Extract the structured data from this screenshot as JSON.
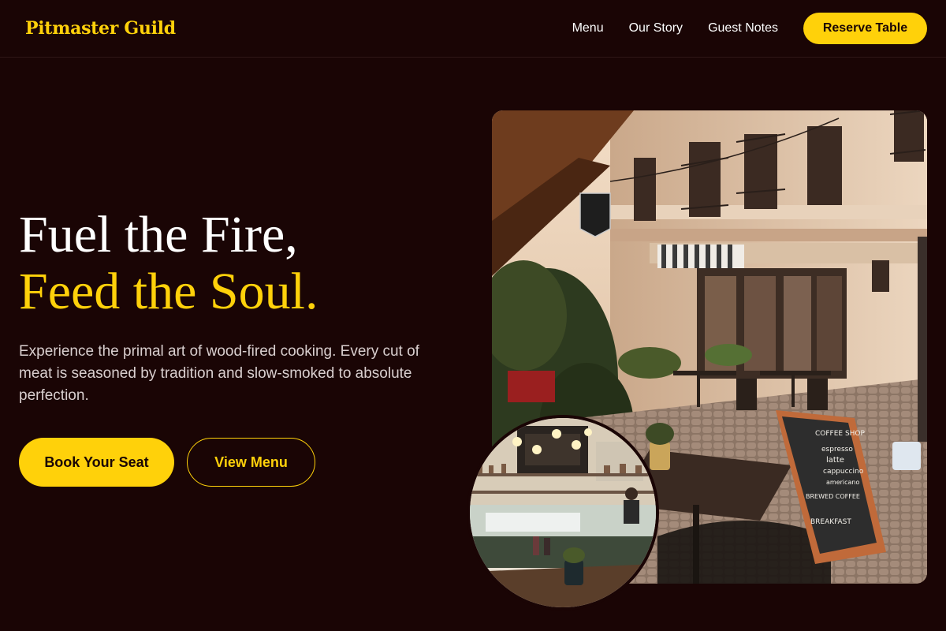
{
  "brand": {
    "name": "Pitmaster Guild"
  },
  "nav": {
    "links": [
      "Menu",
      "Our Story",
      "Guest Notes"
    ],
    "cta": "Reserve Table"
  },
  "hero": {
    "title_line1": "Fuel the Fire,",
    "title_line2": "Feed the Soul.",
    "description": "Experience the primal art of wood-fired cooking. Every cut of meat is seasoned by tradition and slow-smoked to absolute perfection.",
    "primary_button": "Book Your Seat",
    "secondary_button": "View Menu"
  },
  "images": {
    "main": {
      "sign_text": [
        "COFFEE SHOP",
        "espresso",
        "latte",
        "cappuccino",
        "americano",
        "BREWED COFFEE",
        "BREAKFAST"
      ]
    }
  },
  "colors": {
    "background": "#1a0505",
    "accent": "#ffd10a",
    "text": "#ffffff",
    "muted_text": "#d9cfcf"
  }
}
